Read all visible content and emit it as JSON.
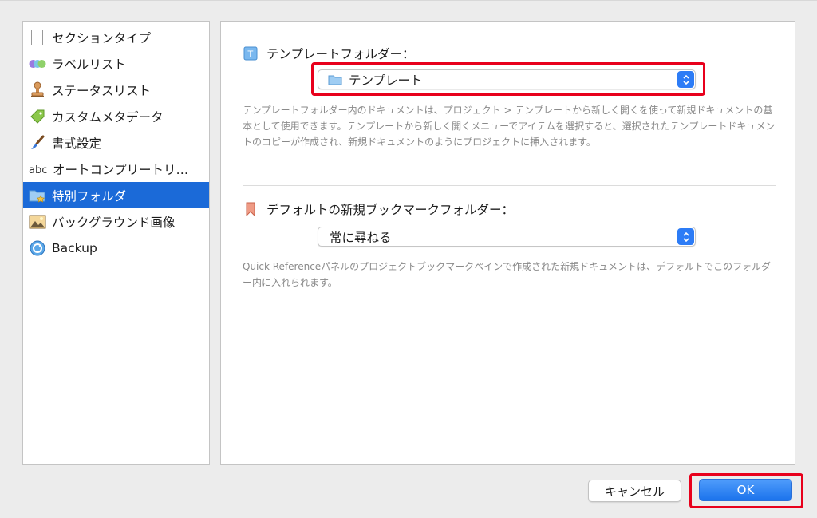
{
  "sidebar": {
    "items": [
      {
        "label": "セクションタイプ",
        "icon": "document-icon"
      },
      {
        "label": "ラベルリスト",
        "icon": "label-circles-icon"
      },
      {
        "label": "ステータスリスト",
        "icon": "stamp-icon"
      },
      {
        "label": "カスタムメタデータ",
        "icon": "tag-icon"
      },
      {
        "label": "書式設定",
        "icon": "brush-icon"
      },
      {
        "label": "オートコンプリートリ…",
        "icon": "abc-icon"
      },
      {
        "label": "特別フォルダ",
        "icon": "special-folder-icon",
        "selected": true
      },
      {
        "label": "バックグラウンド画像",
        "icon": "picture-icon"
      },
      {
        "label": "Backup",
        "icon": "backup-icon"
      }
    ]
  },
  "template_section": {
    "title": "テンプレートフォルダー：",
    "popup_value": "テンプレート",
    "description": "テンプレートフォルダー内のドキュメントは、プロジェクト > テンプレートから新しく開くを使って新規ドキュメントの基本として使用できます。テンプレートから新しく開くメニューでアイテムを選択すると、選択されたテンプレートドキュメントのコピーが作成され、新規ドキュメントのようにプロジェクトに挿入されます。"
  },
  "bookmark_section": {
    "title": "デフォルトの新規ブックマークフォルダー：",
    "popup_value": "常に尋ねる",
    "description": "Quick Referenceパネルのプロジェクトブックマークペインで作成された新規ドキュメントは、デフォルトでこのフォルダー内に入れられます。"
  },
  "buttons": {
    "cancel": "キャンセル",
    "ok": "OK"
  },
  "colors": {
    "selection": "#1b6ad8",
    "highlight": "#e8001c",
    "accent": "#2d7cf6"
  }
}
